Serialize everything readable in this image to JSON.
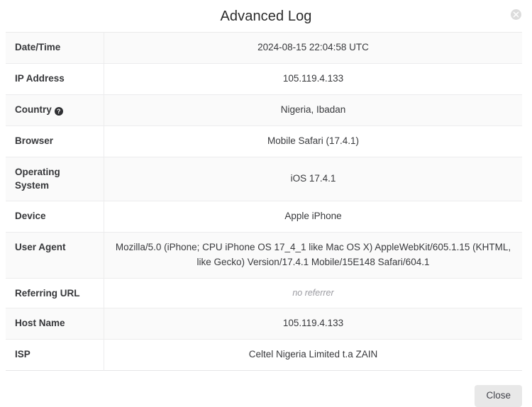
{
  "modal": {
    "title": "Advanced Log",
    "close_icon": "close-circle-icon",
    "footer": {
      "close_label": "Close"
    }
  },
  "table": {
    "rows": [
      {
        "label": "Date/Time",
        "value": "2024-08-15 22:04:58 UTC",
        "help": null,
        "muted": false
      },
      {
        "label": "IP Address",
        "value": "105.119.4.133",
        "help": null,
        "muted": false
      },
      {
        "label": "Country",
        "value": "Nigeria, Ibadan",
        "help": "?",
        "muted": false
      },
      {
        "label": "Browser",
        "value": "Mobile Safari (17.4.1)",
        "help": null,
        "muted": false
      },
      {
        "label": "Operating System",
        "value": "iOS 17.4.1",
        "help": null,
        "muted": false
      },
      {
        "label": "Device",
        "value": "Apple iPhone",
        "help": null,
        "muted": false
      },
      {
        "label": "User Agent",
        "value": "Mozilla/5.0 (iPhone; CPU iPhone OS 17_4_1 like Mac OS X) AppleWebKit/605.1.15 (KHTML, like Gecko) Version/17.4.1 Mobile/15E148 Safari/604.1",
        "help": null,
        "muted": false
      },
      {
        "label": "Referring URL",
        "value": "no referrer",
        "help": null,
        "muted": true
      },
      {
        "label": "Host Name",
        "value": "105.119.4.133",
        "help": null,
        "muted": false
      },
      {
        "label": "ISP",
        "value": "Celtel Nigeria Limited t.a ZAIN",
        "help": null,
        "muted": false
      }
    ]
  },
  "colors": {
    "row_stripe": "#fafafa",
    "row_plain": "#ffffff",
    "border": "#ececed",
    "help_badge": "#2f3033",
    "button": "#e8e8e8",
    "muted_text": "#9b9ba1"
  }
}
